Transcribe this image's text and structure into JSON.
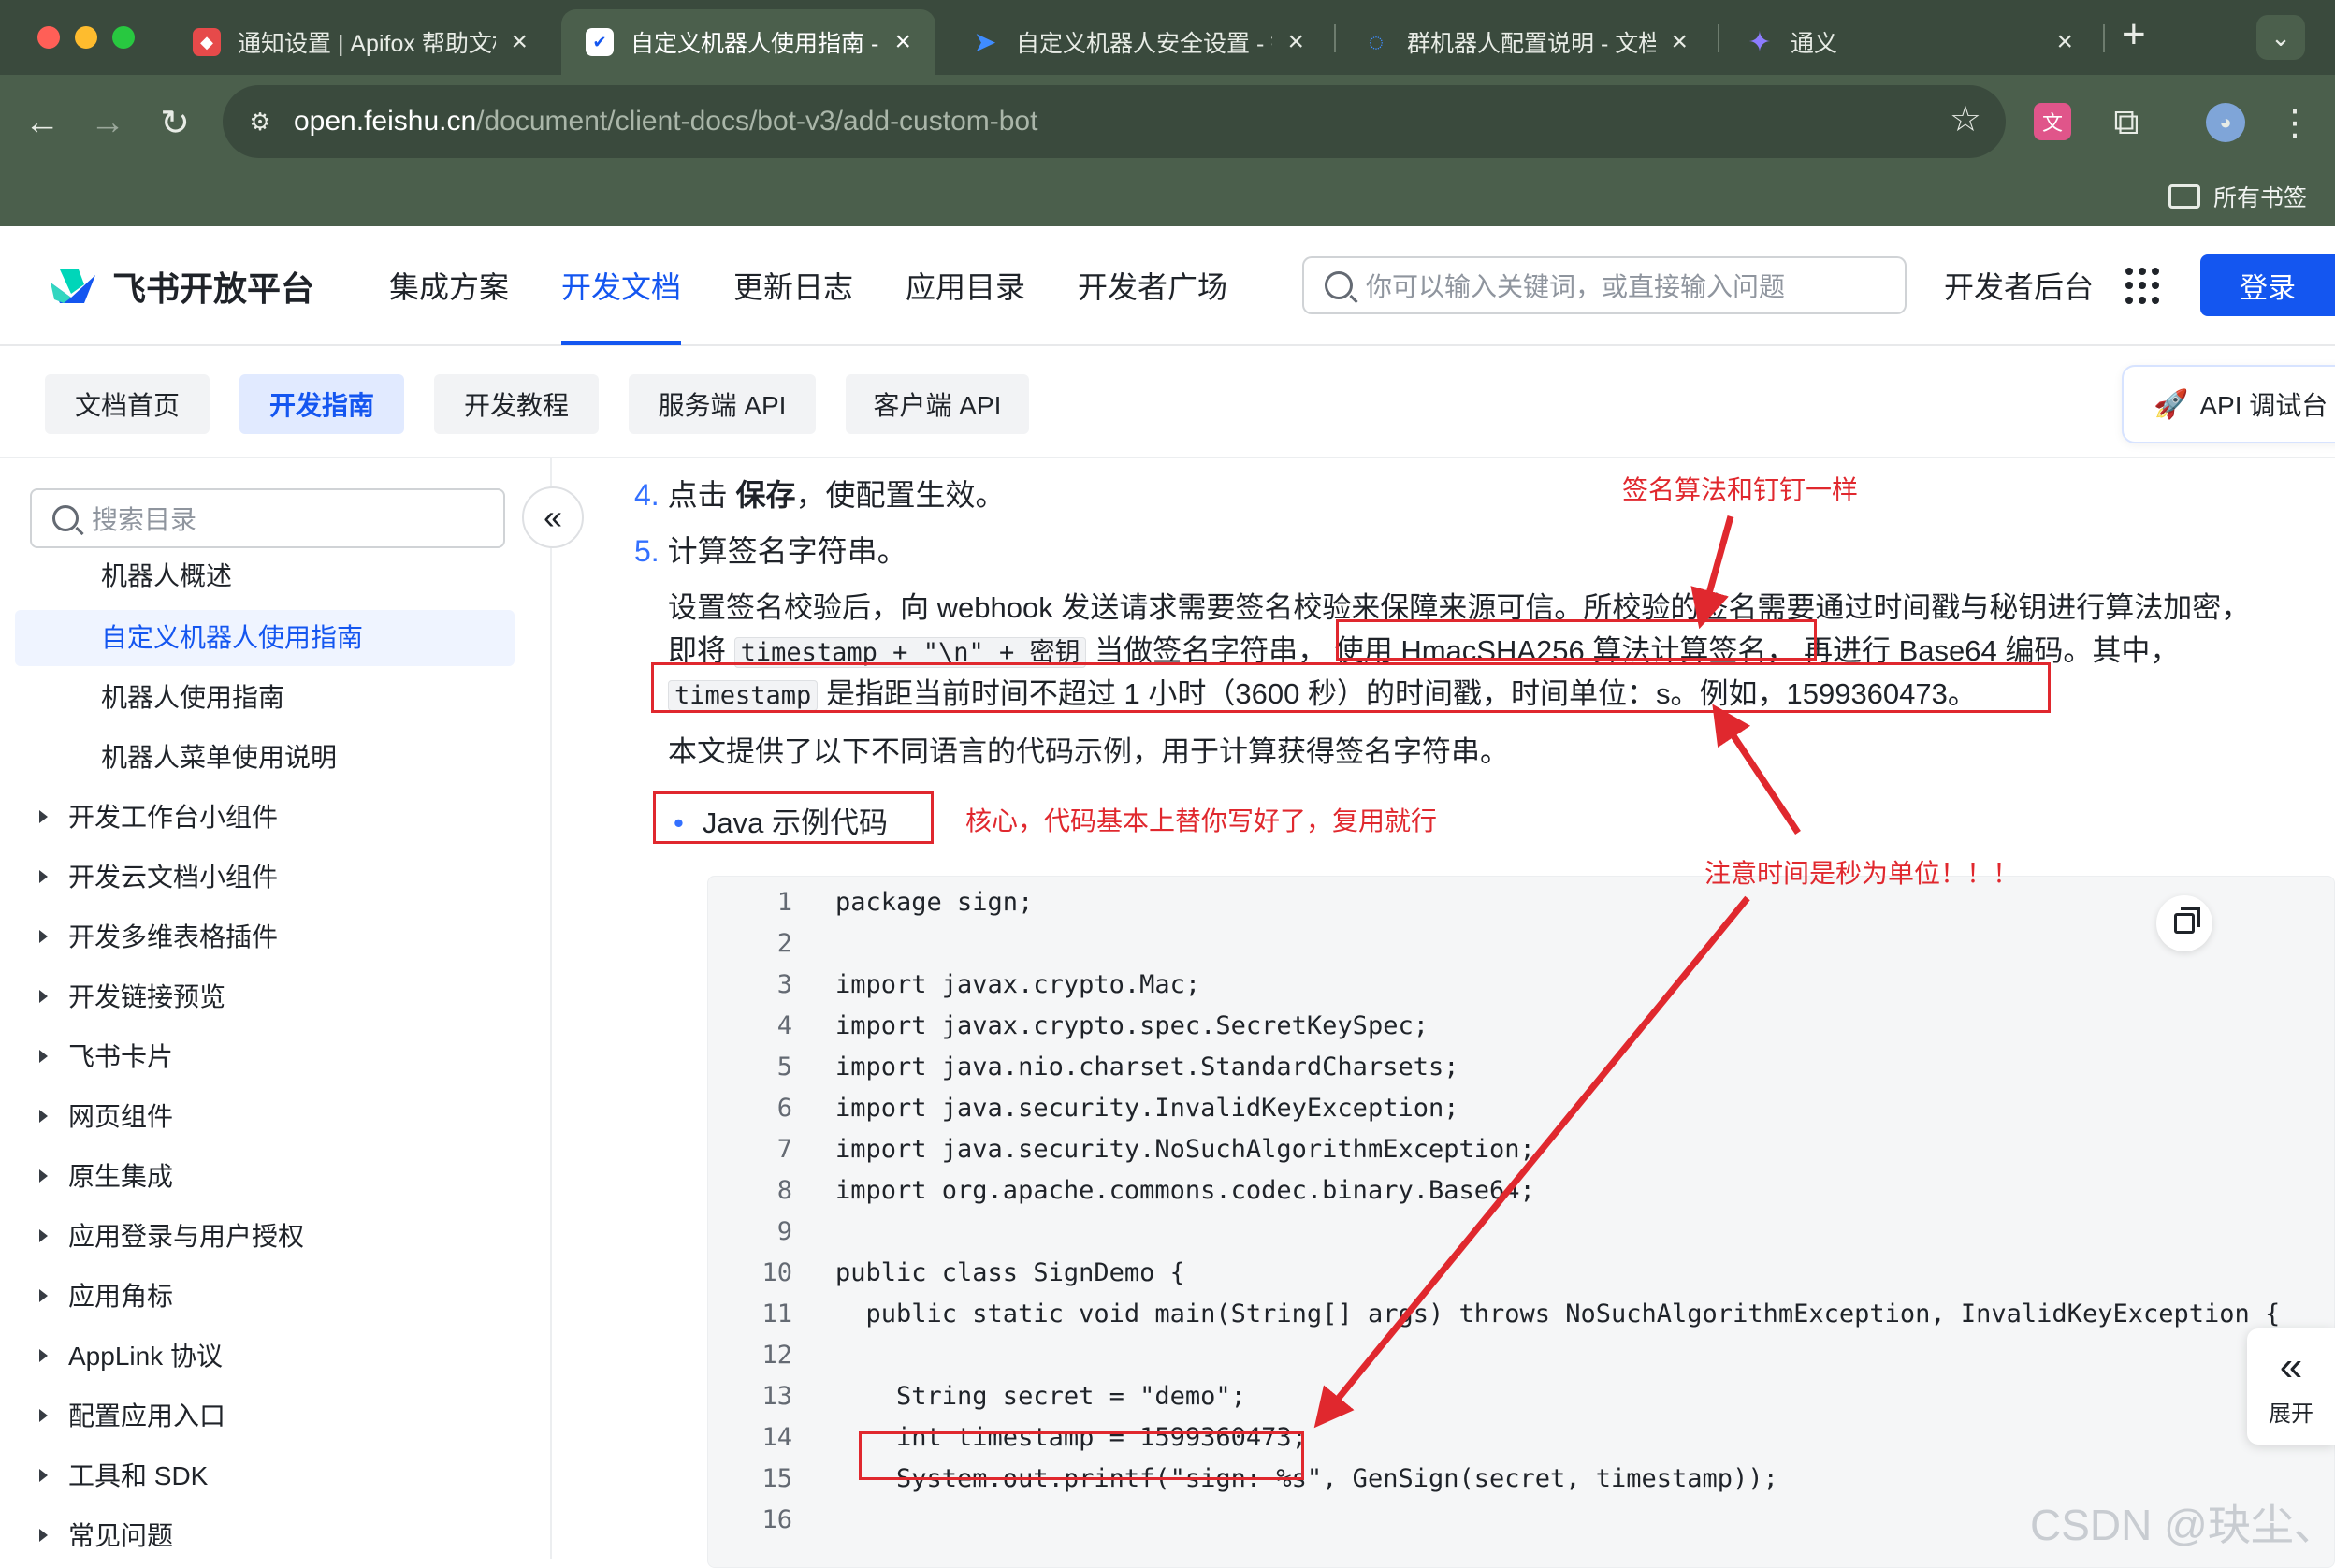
{
  "browser": {
    "tabs": [
      {
        "title": "通知设置 | Apifox 帮助文档",
        "favicon": "apifox-icon"
      },
      {
        "title": "自定义机器人使用指南 - 开发指南",
        "favicon": "feishu-doc-icon",
        "active": true
      },
      {
        "title": "自定义机器人安全设置 - 钉钉",
        "favicon": "dingtalk-icon"
      },
      {
        "title": "群机器人配置说明 - 文档",
        "favicon": "wecom-icon"
      },
      {
        "title": "通义",
        "favicon": "tongyi-icon"
      }
    ],
    "new_tab": "+",
    "url_host": "open.feishu.cn",
    "url_path": "/document/client-docs/bot-v3/add-custom-bot",
    "bookmarks_all": "所有书签"
  },
  "site": {
    "logo_text": "飞书开放平台",
    "nav": [
      "集成方案",
      "开发文档",
      "更新日志",
      "应用目录",
      "开发者广场"
    ],
    "search_placeholder": "你可以输入关键词，或直接输入问题",
    "dev_console": "开发者后台",
    "login": "登录",
    "subnav": [
      "文档首页",
      "开发指南",
      "开发教程",
      "服务端 API",
      "客户端 API"
    ],
    "api_debug": "API 调试台"
  },
  "sidebar": {
    "search_placeholder": "搜索目录",
    "sub_items": [
      "机器人概述",
      "自定义机器人使用指南",
      "机器人使用指南",
      "机器人菜单使用说明"
    ],
    "items": [
      "开发工作台小组件",
      "开发云文档小组件",
      "开发多维表格插件",
      "开发链接预览",
      "飞书卡片",
      "网页组件",
      "原生集成",
      "应用登录与用户授权",
      "应用角标",
      "AppLink 协议",
      "配置应用入口",
      "工具和 SDK",
      "常见问题"
    ]
  },
  "content": {
    "step4_num": "4.",
    "step4_pre": "点击",
    "step4_bold": "保存",
    "step4_post": "，使配置生效。",
    "step5_num": "5.",
    "step5_text": "计算签名字符串。",
    "para1_line1": "设置签名校验后，向 webhook 发送请求需要签名校验来保障来源可信。所校验的签名需要通过时间戳与秘钥进行算法加密，",
    "para1_l2_a": "即将",
    "para1_l2_code": "timestamp + \"\\n\" + 密钥",
    "para1_l2_b": "当做签名字符串，",
    "para1_l2_c": "使用 HmacSHA256 算法计算签名，",
    "para1_l2_d": "再进行 Base64 编码。其中，",
    "para1_l3_code": "timestamp",
    "para1_l3_text": "是指距当前时间不超过 1 小时（3600 秒）的时间戳，时间单位：s。例如，1599360473。",
    "para2": "本文提供了以下不同语言的代码示例，用于计算获得签名字符串。",
    "bullet": "Java 示例代码",
    "expand": "展开"
  },
  "annotations": {
    "a1": "签名算法和钉钉一样",
    "a2": "核心，代码基本上替你写好了，复用就行",
    "a3": "注意时间是秒为单位！！！",
    "color": "#e0282e"
  },
  "code": [
    "package sign;",
    "",
    "import javax.crypto.Mac;",
    "import javax.crypto.spec.SecretKeySpec;",
    "import java.nio.charset.StandardCharsets;",
    "import java.security.InvalidKeyException;",
    "import java.security.NoSuchAlgorithmException;",
    "import org.apache.commons.codec.binary.Base64;",
    "",
    "public class SignDemo {",
    "  public static void main(String[] args) throws NoSuchAlgorithmException, InvalidKeyException {",
    "",
    "    String secret = \"demo\";",
    "    int timestamp = 1599360473;",
    "    System.out.printf(\"sign: %s\", GenSign(secret, timestamp));",
    ""
  ],
  "watermark": "CSDN @玦尘、",
  "colors": {
    "accent": "#1456f0",
    "link": "#3370ff",
    "chrome_dark": "#3a4a3d",
    "chrome": "#4b5f4c"
  }
}
